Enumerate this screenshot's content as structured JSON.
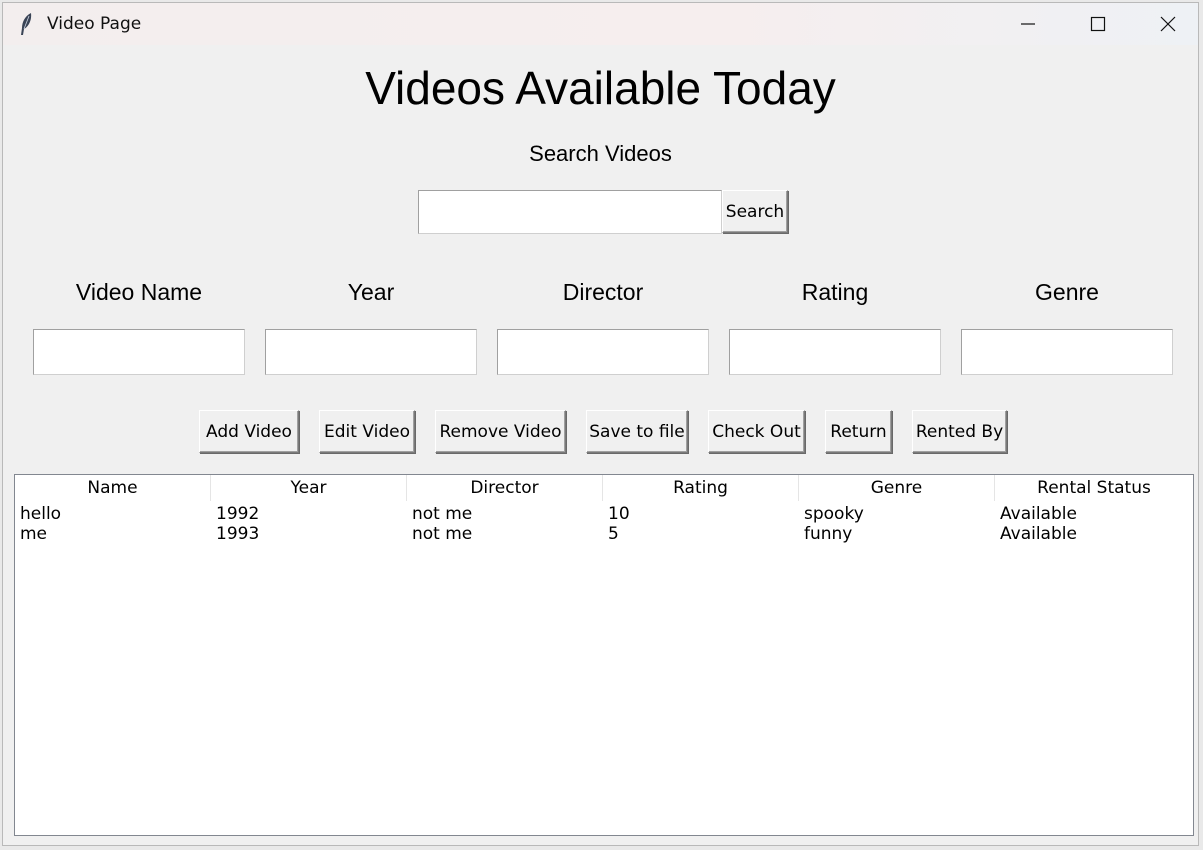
{
  "window": {
    "title": "Video Page"
  },
  "header": {
    "title": "Videos Available Today",
    "search_label": "Search Videos",
    "search_value": "",
    "search_button": "Search"
  },
  "form": {
    "fields": [
      {
        "label": "Video Name",
        "value": ""
      },
      {
        "label": "Year",
        "value": ""
      },
      {
        "label": "Director",
        "value": ""
      },
      {
        "label": "Rating",
        "value": ""
      },
      {
        "label": "Genre",
        "value": ""
      }
    ]
  },
  "actions": [
    {
      "label": "Add Video"
    },
    {
      "label": "Edit Video"
    },
    {
      "label": "Remove Video"
    },
    {
      "label": "Save to file"
    },
    {
      "label": "Check Out"
    },
    {
      "label": "Return"
    },
    {
      "label": "Rented By"
    }
  ],
  "table": {
    "columns": [
      "Name",
      "Year",
      "Director",
      "Rating",
      "Genre",
      "Rental Status"
    ],
    "rows": [
      [
        "hello",
        "1992",
        "not me",
        "10",
        "spooky",
        "Available"
      ],
      [
        "me",
        "1993",
        "not me",
        "5",
        "funny",
        "Available"
      ]
    ]
  },
  "icons": {
    "app": "feather-icon",
    "minimize": "minimize-icon",
    "maximize": "maximize-icon",
    "close": "close-icon"
  }
}
